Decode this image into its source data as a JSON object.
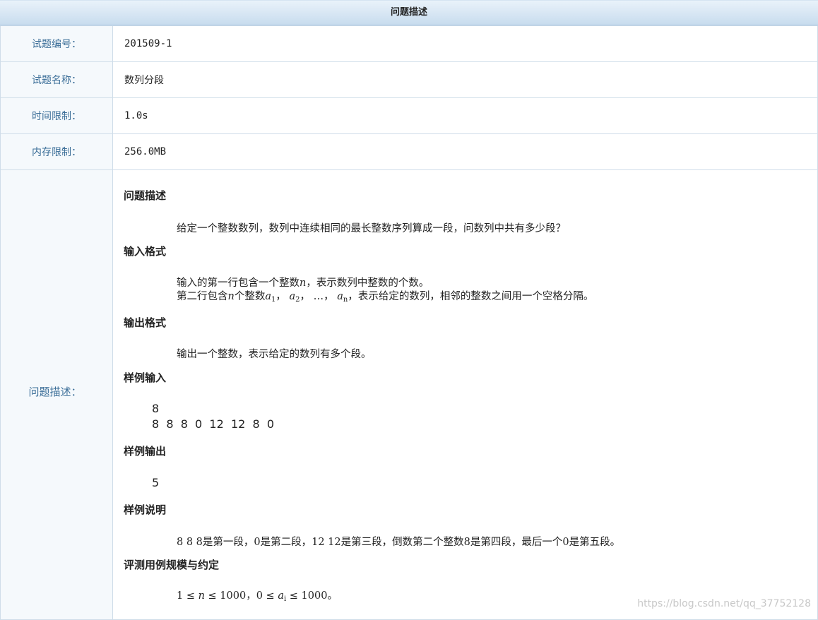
{
  "header": {
    "title": "问题描述"
  },
  "rows": [
    {
      "label": "试题编号：",
      "value": "201509-1"
    },
    {
      "label": "试题名称：",
      "value": "数列分段"
    },
    {
      "label": "时间限制：",
      "value": "1.0s"
    },
    {
      "label": "内存限制：",
      "value": "256.0MB"
    }
  ],
  "desc_label": "问题描述：",
  "sections": {
    "problem": {
      "title": "问题描述",
      "text": "给定一个整数数列，数列中连续相同的最长整数序列算成一段，问数列中共有多少段？"
    },
    "input": {
      "title": "输入格式",
      "line1_a": "输入的第一行包含一个整数",
      "line1_var": "n",
      "line1_b": "，表示数列中整数的个数。",
      "line2_a": "第二行包含",
      "line2_var": "n",
      "line2_b": "个整数",
      "a": "a",
      "s1": "1",
      "s2": "2",
      "sn": "n",
      "sep": "，",
      "dots": "…",
      "line2_c": "，表示给定的数列，相邻的整数之间用一个空格分隔。"
    },
    "output": {
      "title": "输出格式",
      "text": "输出一个整数，表示给定的数列有多个段。"
    },
    "sample_input": {
      "title": "样例输入",
      "line1": "8",
      "line2": "8  8  8  0  12  12  8  0"
    },
    "sample_output": {
      "title": "样例输出",
      "line1": "5"
    },
    "sample_explain": {
      "title": "样例说明",
      "text": "8 8 8是第一段，0是第二段，12 12是第三段，倒数第二个整数8是第四段，最后一个0是第五段。"
    },
    "constraints": {
      "title": "评测用例规模与约定",
      "p1": "1 ≤ ",
      "n": "n",
      "p2": " ≤ 1000，0 ≤ ",
      "ai": "a",
      "isub": "i",
      "p3": " ≤ 1000。"
    }
  },
  "watermark": "https://blog.csdn.net/qq_37752128"
}
